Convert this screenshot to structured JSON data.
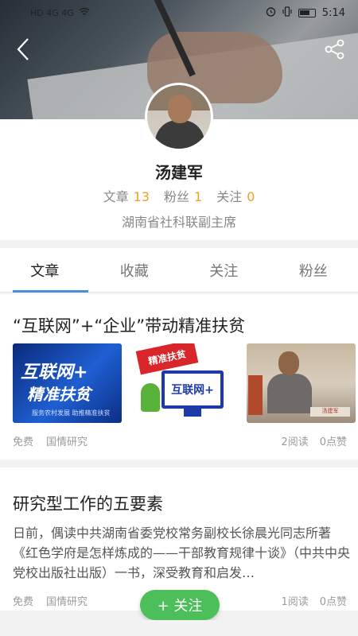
{
  "status_bar": {
    "time": "5:14",
    "left_text": "HD 4G 4G"
  },
  "nav": {
    "back_icon": "chevron-left-icon",
    "share_icon": "share-icon"
  },
  "profile": {
    "name": "汤建军",
    "stats": [
      {
        "label": "文章",
        "value": "13"
      },
      {
        "label": "粉丝",
        "value": "1"
      },
      {
        "label": "关注",
        "value": "0"
      }
    ],
    "bio": "湖南省社科联副主席"
  },
  "tabs": [
    {
      "label": "文章",
      "active": true
    },
    {
      "label": "收藏",
      "active": false
    },
    {
      "label": "关注",
      "active": false
    },
    {
      "label": "粉丝",
      "active": false
    }
  ],
  "articles": [
    {
      "title": "“互联网”+“企业”带动精准扶贫",
      "thumbs": [
        {
          "line1": "互联网+",
          "line2": "精准扶贫",
          "caption": "服务农村发展   助推精准扶贫"
        },
        {
          "flag": "精准扶贫",
          "screen": "互联网+"
        },
        {
          "plate": "汤建军"
        }
      ],
      "price": "免费",
      "category": "国情研究",
      "reads": "2阅读",
      "likes": "0点赞"
    },
    {
      "title": "研究型工作的五要素",
      "excerpt": "日前，偶读中共湖南省委党校常务副校长徐晨光同志所著《红色学府是怎样炼成的——干部教育规律十谈》（中共中央党校出版社出版）一书，深受教育和启发…",
      "price": "免费",
      "category": "国情研究",
      "reads": "1阅读",
      "likes": "0点赞"
    }
  ],
  "follow_button": {
    "label": "+ 关注"
  },
  "colors": {
    "accent_blue": "#4a8fd6",
    "stat_orange": "#f0a01e",
    "follow_green": "#4cbf5a"
  }
}
